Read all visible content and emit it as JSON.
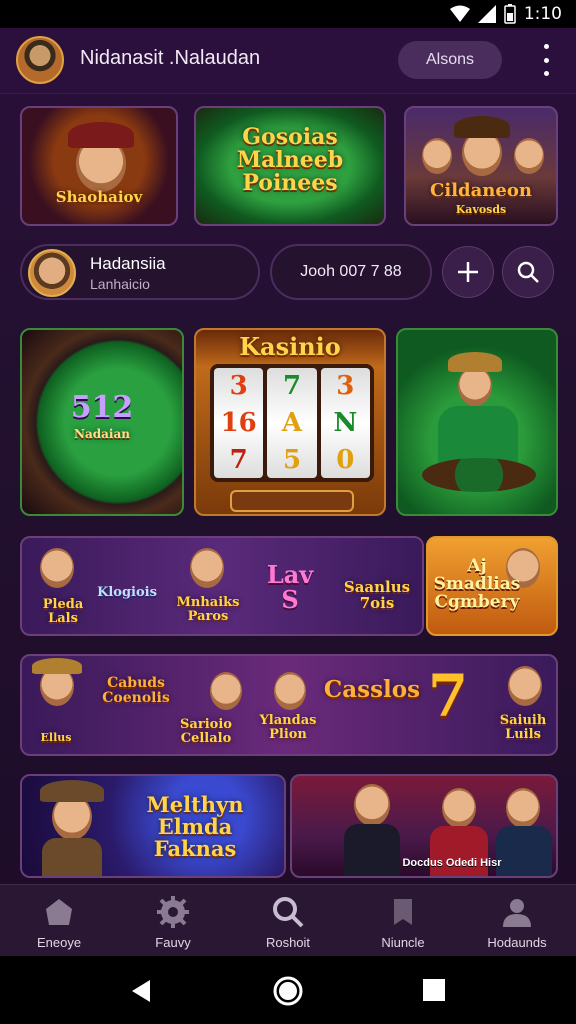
{
  "status_bar": {
    "time": "1:10"
  },
  "header": {
    "title": "Nidanasit .Nalaudan",
    "action_label": "Alsons"
  },
  "banners": {
    "left": "Shaohaiov",
    "center": "Gosoias Malneeb Poinees",
    "right_title": "Cildaneon",
    "right_sub": "Kavosds"
  },
  "user": {
    "name": "Hadansiia",
    "sub": "Lanhaicio"
  },
  "balance_text": "Jooh 007 7 88",
  "featured": {
    "left_label": "512",
    "left_sub": "Nadaian",
    "slot_title": "Kasinio",
    "reels": [
      [
        "3",
        "7",
        "3"
      ],
      [
        "16",
        "A",
        "N"
      ],
      [
        "7",
        "5",
        "0"
      ]
    ]
  },
  "row1": {
    "labels": [
      "Pleda Lals",
      "Klogiois",
      "Mnhaiks Paros",
      "Lav S",
      "Saanlus 7ois"
    ],
    "promo": "Aj Smadlias Cgmbery"
  },
  "row2": {
    "labels": [
      "Cabuds Coenolis",
      "Ellus",
      "Sarioio Cellalo",
      "Ylandas Plion",
      "Casslos",
      "7",
      "Saiuih Luils"
    ]
  },
  "row3": {
    "left": "Melthyn Elmda Faknas",
    "right": "Docdus Odedi Hisr"
  },
  "nav": [
    {
      "label": "Eneoye",
      "icon": "home-icon"
    },
    {
      "label": "Fauvy",
      "icon": "gear-icon"
    },
    {
      "label": "Roshoit",
      "icon": "search-icon"
    },
    {
      "label": "Niuncle",
      "icon": "bookmark-icon"
    },
    {
      "label": "Hodaunds",
      "icon": "profile-icon"
    }
  ],
  "colors": {
    "accent": "#ffd44a",
    "background": "#22102f",
    "nav": "#2a1733"
  }
}
